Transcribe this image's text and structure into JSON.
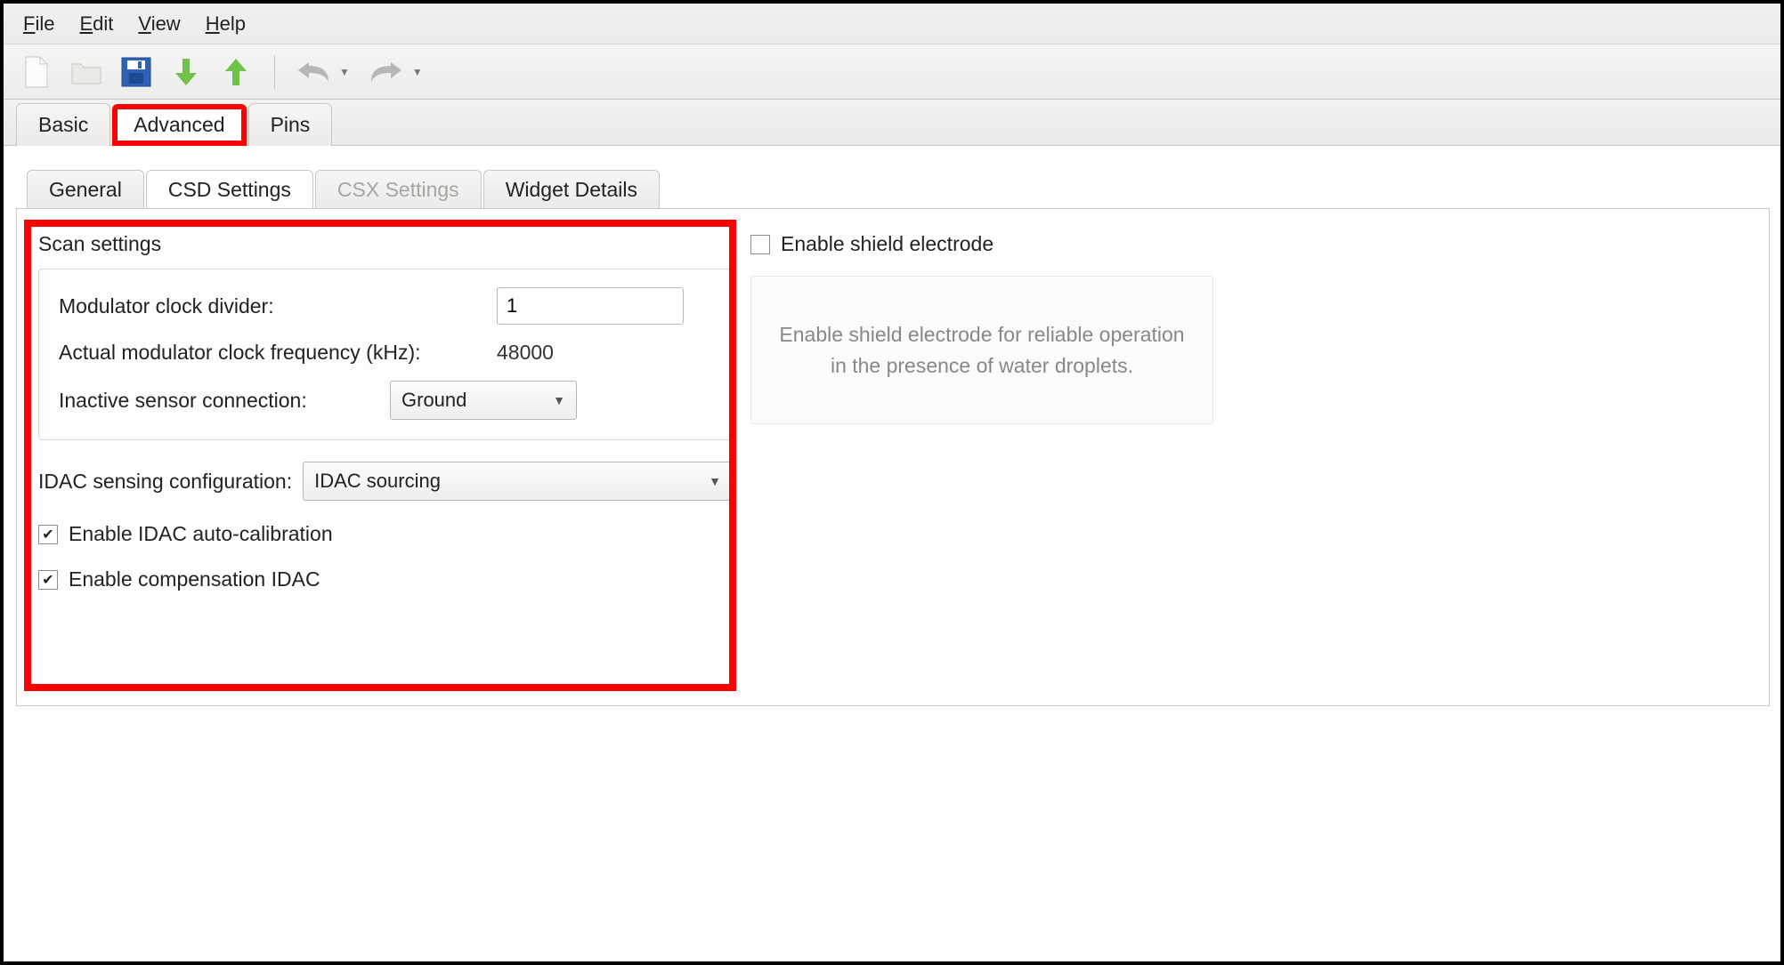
{
  "menubar": {
    "file": "File",
    "edit": "Edit",
    "view": "View",
    "help": "Help"
  },
  "toolbar": {
    "icons": [
      "new",
      "open",
      "save",
      "download",
      "upload",
      "undo",
      "redo"
    ]
  },
  "top_tabs": {
    "basic": "Basic",
    "advanced": "Advanced",
    "pins": "Pins",
    "active": "Advanced"
  },
  "sub_tabs": {
    "general": "General",
    "csd": "CSD Settings",
    "csx": "CSX Settings",
    "widget": "Widget Details",
    "active": "CSD Settings",
    "disabled": [
      "CSX Settings"
    ]
  },
  "scan": {
    "heading": "Scan settings",
    "modulator_label": "Modulator clock divider:",
    "modulator_value": "1",
    "actual_freq_label": "Actual modulator clock frequency (kHz):",
    "actual_freq_value": "48000",
    "inactive_label": "Inactive sensor connection:",
    "inactive_value": "Ground"
  },
  "idac": {
    "config_label": "IDAC sensing configuration:",
    "config_value": "IDAC sourcing",
    "autocal_label": "Enable IDAC auto-calibration",
    "autocal_checked": true,
    "comp_label": "Enable compensation IDAC",
    "comp_checked": true
  },
  "shield": {
    "enable_label": "Enable shield electrode",
    "enable_checked": false,
    "description": "Enable shield electrode for reliable operation in the presence of water droplets."
  },
  "highlight_color": "#fb0101"
}
